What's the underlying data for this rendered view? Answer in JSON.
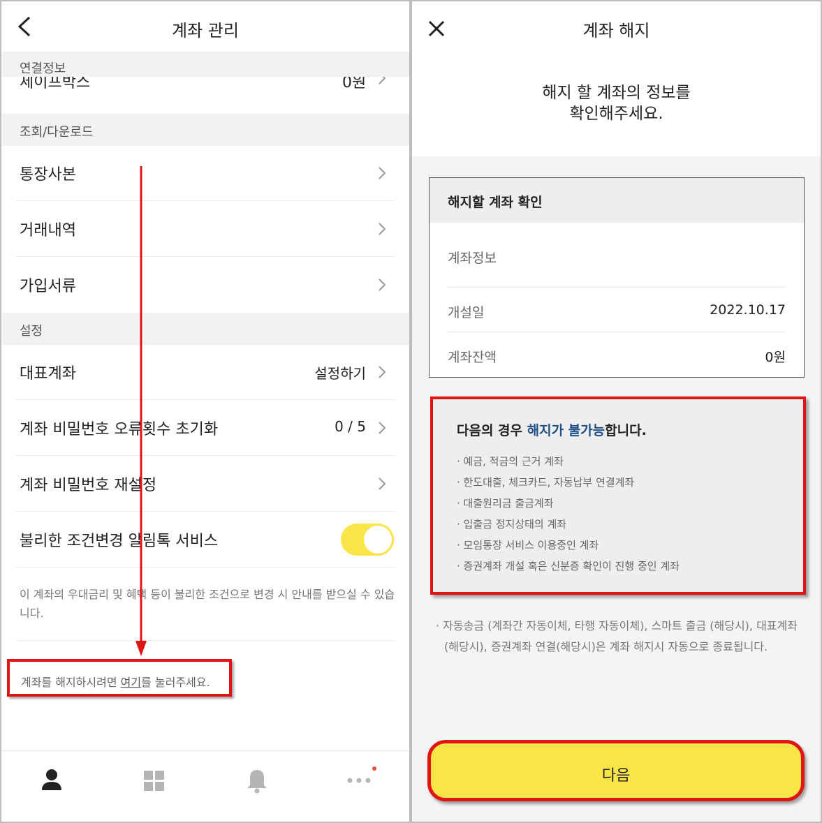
{
  "left_screen": {
    "header": {
      "title": "계좌 관리"
    },
    "sections": {
      "connection": "연결정보",
      "query": "조회/다운로드",
      "settings": "설정"
    },
    "peek_row": {
      "label": "세이프박스",
      "value": "0원"
    },
    "query_items": [
      {
        "label": "통장사본"
      },
      {
        "label": "거래내역"
      },
      {
        "label": "가입서류"
      }
    ],
    "settings_items": [
      {
        "label": "대표계좌",
        "value": "설정하기"
      },
      {
        "label": "계좌 비밀번호 오류횟수 초기화",
        "value": "0 / 5"
      },
      {
        "label": "계좌 비밀번호 재설정"
      },
      {
        "label": "불리한 조건변경 알림톡 서비스",
        "toggle_on": true
      }
    ],
    "notice": "이 계좌의 우대금리 및 혜택 등이 불리한 조건으로 변경 시 안내를 받으실 수 있습니다.",
    "cancel_prompt": {
      "before": "계좌를 해지하시려면 ",
      "link": "여기",
      "after": "를 눌러주세요."
    },
    "tabbar": [
      "person-icon",
      "grid-icon",
      "bell-icon",
      "more-icon"
    ],
    "colors": {
      "toggle": "#f9e547",
      "highlight": "#e01414",
      "notification_dot": "#e8503a"
    }
  },
  "right_screen": {
    "header": {
      "title": "계좌 해지"
    },
    "headline": [
      "해지 할 계좌의 정보를",
      "확인해주세요."
    ],
    "card": {
      "title": "해지할 계좌 확인",
      "rows": [
        {
          "label": "계좌정보",
          "value": ""
        },
        {
          "label": "개설일",
          "value": "2022.10.17"
        },
        {
          "label": "계좌잔액",
          "value": "0원"
        }
      ]
    },
    "warning": {
      "title_before": "다음의 경우 ",
      "title_accent": "해지가 불가능",
      "title_after": "합니다.",
      "items": [
        "예금, 적금의 근거 계좌",
        "한도대출, 체크카드, 자동납부 연결계좌",
        "대출원리금 출금계좌",
        "입출금 정지상태의 계좌",
        "모임통장 서비스 이용중인 계좌",
        "증권계좌 개설 혹은 신분증 확인이 진행 중인 계좌"
      ]
    },
    "auto_note": "자동송금 (계좌간 자동이체, 타행 자동이체), 스마트 출금 (해당시), 대표계좌 (해당시), 증권계좌 연결(해당시)은 계좌 해지시 자동으로 종료됩니다.",
    "next_button": "다음",
    "colors": {
      "button": "#f9e547",
      "accent_text": "#1f4f86"
    }
  }
}
